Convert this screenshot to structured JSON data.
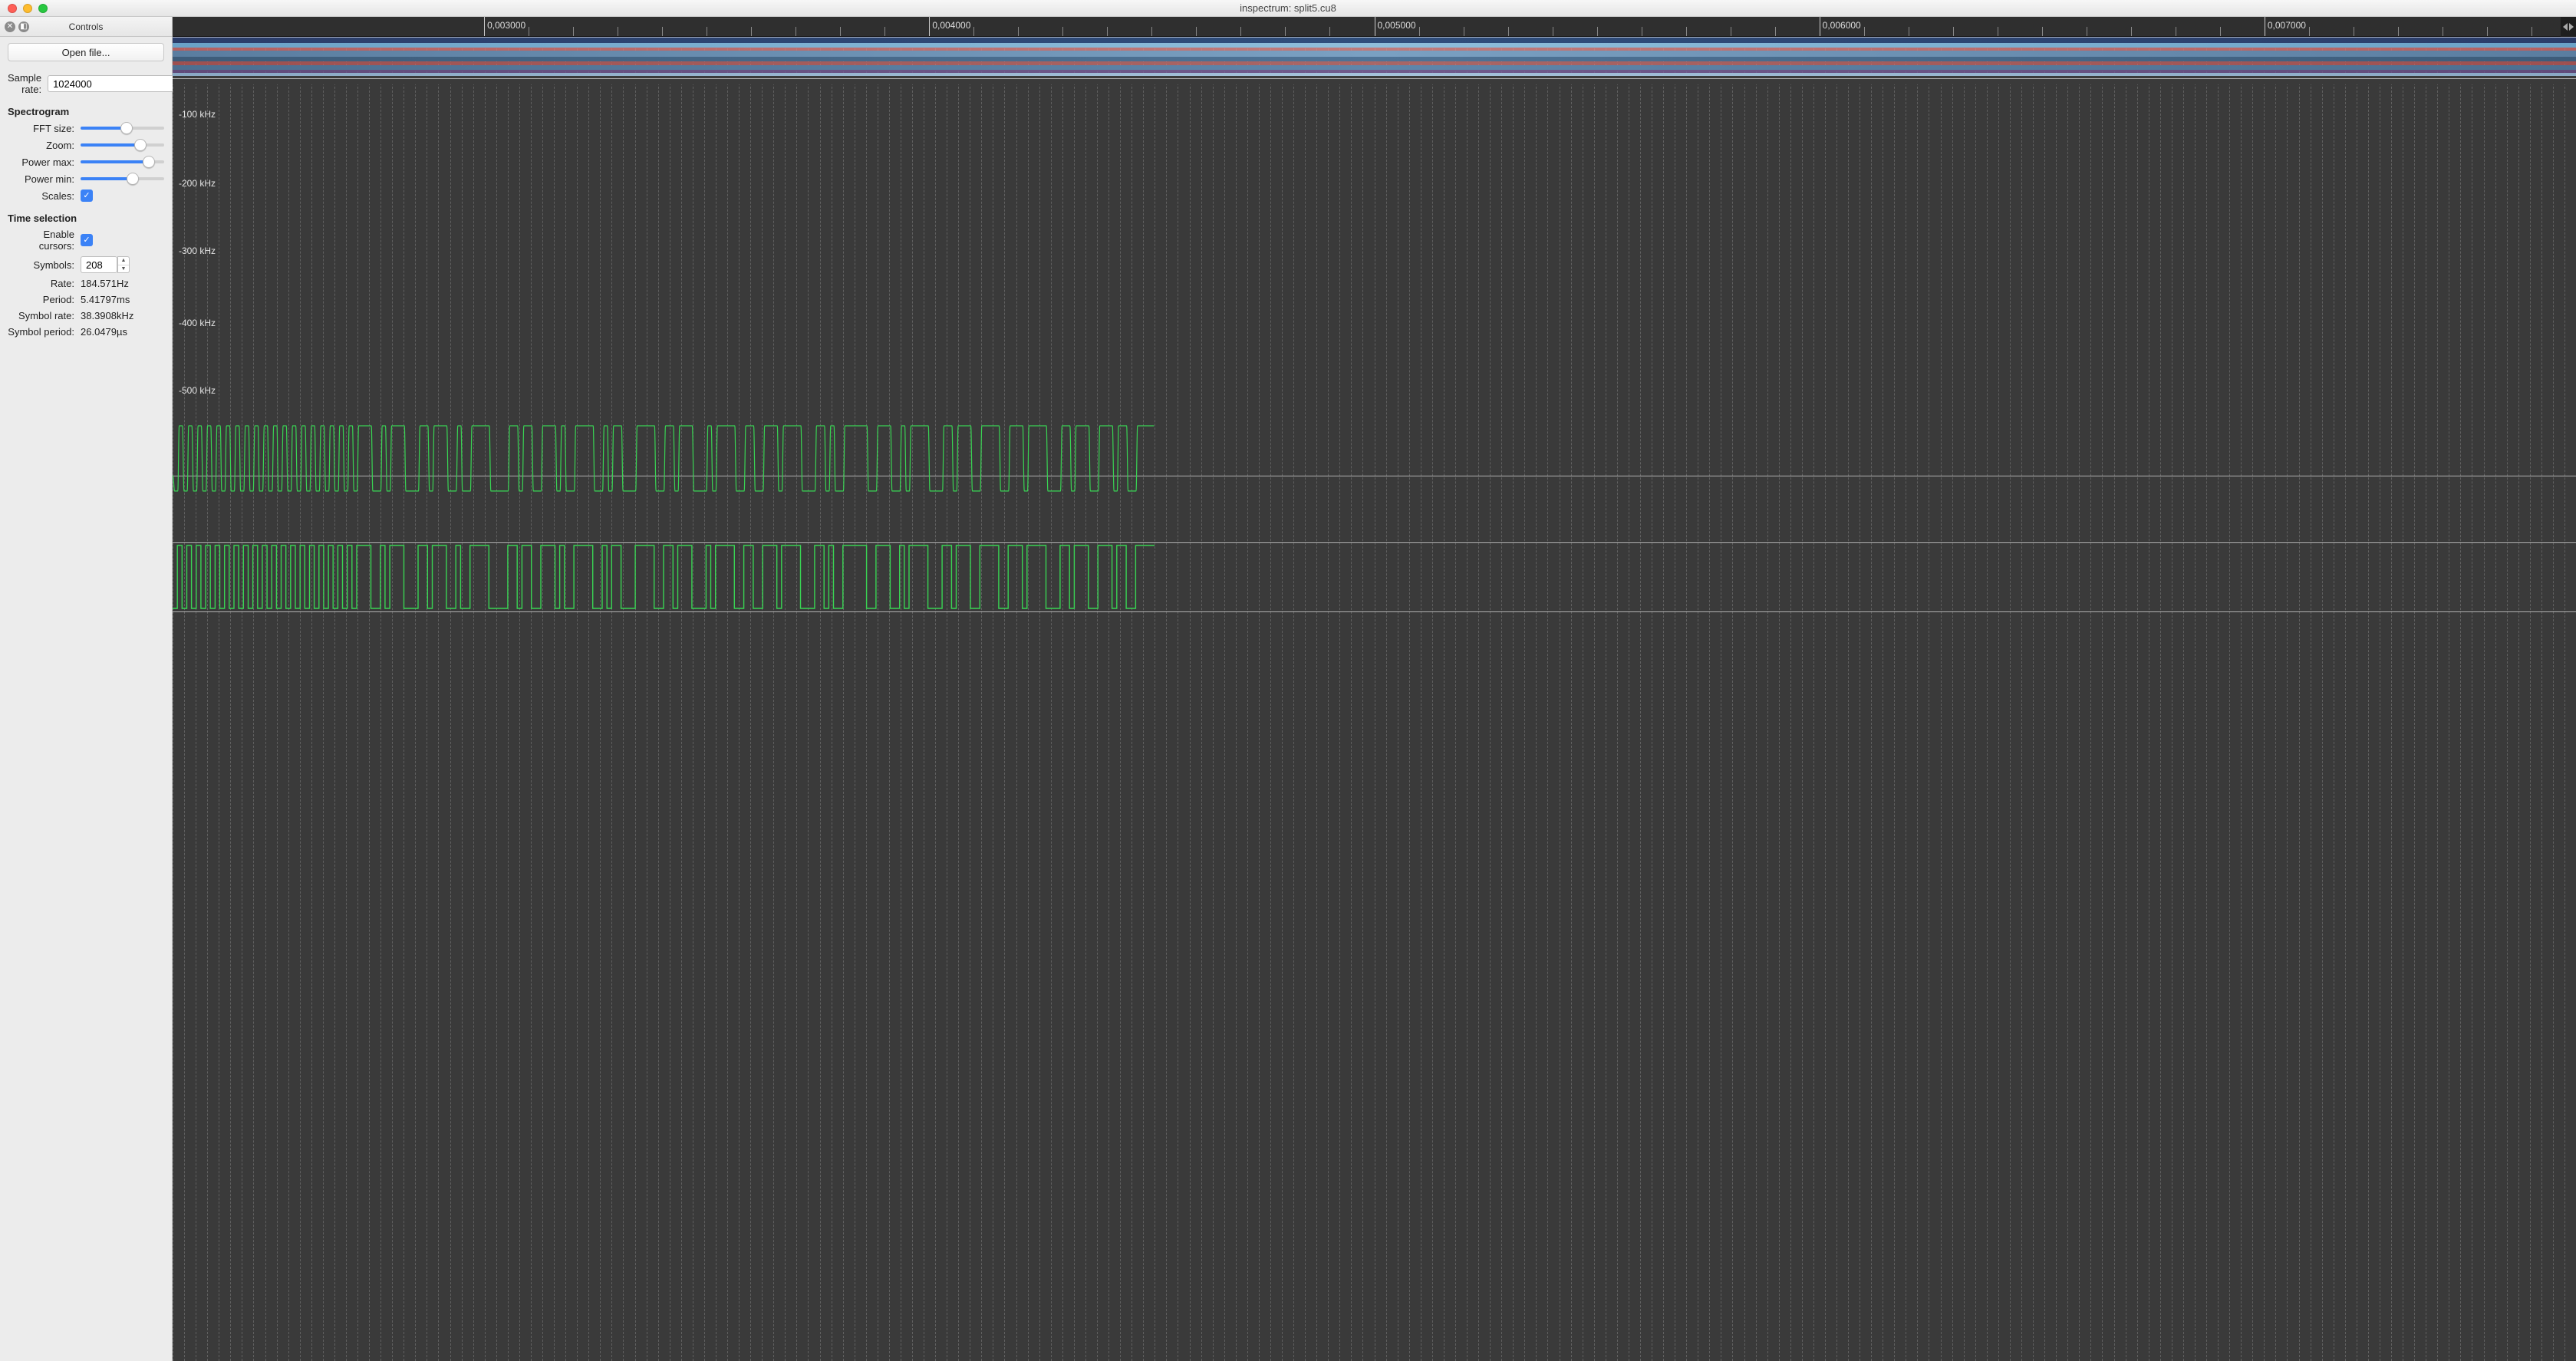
{
  "window": {
    "title": "inspectrum: split5.cu8"
  },
  "sidebar": {
    "header": "Controls",
    "open_file": "Open file...",
    "sample_rate_label": "Sample rate:",
    "sample_rate_value": "1024000",
    "spectrogram": {
      "title": "Spectrogram",
      "fft_size_label": "FFT size:",
      "fft_size_pct": 55,
      "zoom_label": "Zoom:",
      "zoom_pct": 72,
      "power_max_label": "Power max:",
      "power_max_pct": 82,
      "power_min_label": "Power min:",
      "power_min_pct": 62,
      "scales_label": "Scales:",
      "scales_checked": true
    },
    "time_selection": {
      "title": "Time selection",
      "enable_cursors_label": "Enable cursors:",
      "enable_cursors_checked": true,
      "symbols_label": "Symbols:",
      "symbols_value": "208",
      "rate_label": "Rate:",
      "rate_value": "184.571Hz",
      "period_label": "Period:",
      "period_value": "5.41797ms",
      "symbol_rate_label": "Symbol rate:",
      "symbol_rate_value": "38.3908kHz",
      "symbol_period_label": "Symbol period:",
      "symbol_period_value": "26.0479µs"
    }
  },
  "time_axis": {
    "ticks": [
      "0,003000",
      "0,004000",
      "0,005000",
      "0,006000",
      "0,007000"
    ]
  },
  "freq_axis": {
    "ticks": [
      "-100 kHz",
      "-200 kHz",
      "-300 kHz",
      "-400 kHz",
      "-500 kHz"
    ]
  }
}
